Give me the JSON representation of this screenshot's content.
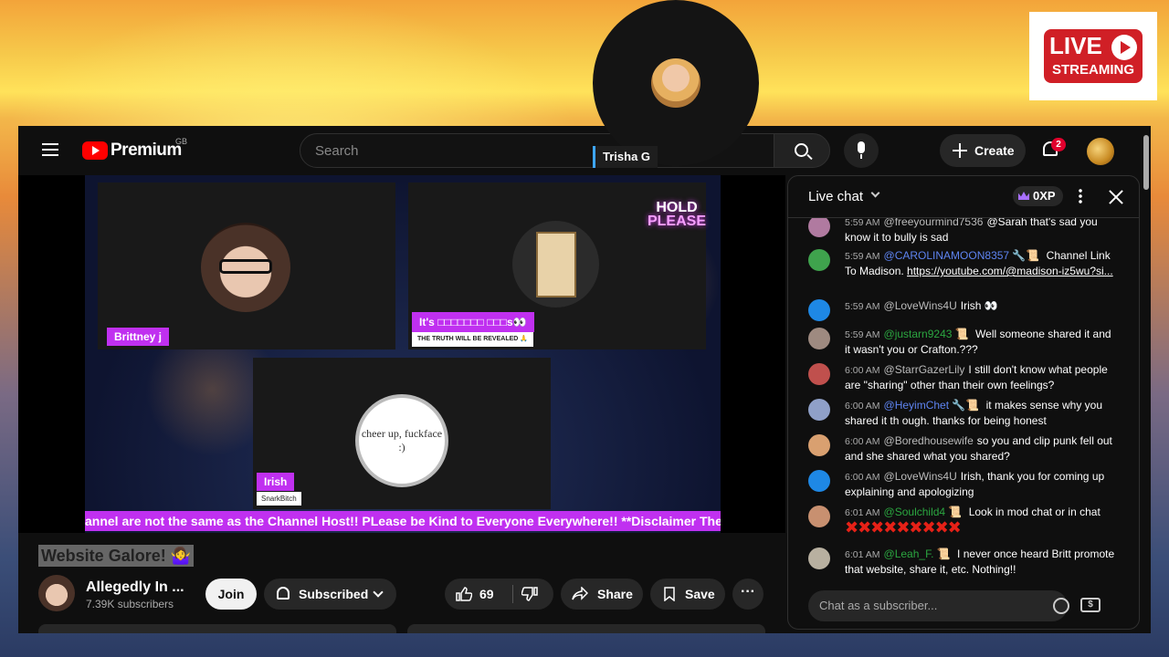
{
  "overlay": {
    "host_name": "Trisha G",
    "live_badge": {
      "word": "LIVE",
      "sub": "STREAMING"
    }
  },
  "topbar": {
    "logo_text": "Premium",
    "logo_region": "GB",
    "search_placeholder": "Search",
    "create_label": "Create",
    "notification_count": "2"
  },
  "video": {
    "participants": [
      {
        "name": "Brittney j"
      },
      {
        "name": "It's □□□□□□□ □□□s👀",
        "subtitle": "THE TRUTH WILL BE REVEALED 🙏"
      },
      {
        "name": "Irish",
        "subtitle": "SnarkBitch",
        "note": "cheer up, fuckface :)"
      }
    ],
    "hold_line1": "HOLD",
    "hold_line2": "PLEASE",
    "ticker": "annel are not the same as the Channel Host!! PLease be Kind to Everyone Everywhere!! **Disclaimer The M"
  },
  "meta": {
    "title": "Website Galore! 🤷‍♀️",
    "channel_name": "Allegedly In ...",
    "subscribers": "7.39K subscribers",
    "join_label": "Join",
    "subscribed_label": "Subscribed",
    "like_count": "69",
    "share_label": "Share",
    "save_label": "Save",
    "more_label": "···"
  },
  "chat": {
    "title": "Live chat",
    "xp": "0XP",
    "input_placeholder": "Chat as a subscriber...",
    "money_icon": "$",
    "messages": [
      {
        "time": "5:59 AM",
        "user": "@freeyourmind7536",
        "user_color": "#bbbbbb",
        "text": "@Sarah that's sad you know it to bully is sad",
        "avatar": "#b07aa0"
      },
      {
        "time": "5:59 AM",
        "user": "@CAROLINAMOON8357 🔧📜",
        "user_color": "#5e84f1",
        "text": "Channel Link To Madison.",
        "link": "https://youtube.com/@madison-iz5wu?si...",
        "avatar": "#3fa34d"
      },
      {
        "time": "5:59 AM",
        "user": "@LoveWins4U",
        "user_color": "#bbbbbb",
        "text": "Irish 👀",
        "avatar": "#1e88e5"
      },
      {
        "time": "5:59 AM",
        "user": "@justarn9243 📜",
        "user_color": "#2ba640",
        "text": "Well someone shared it and it wasn't you or Crafton.???",
        "avatar": "#9e8a80"
      },
      {
        "time": "6:00 AM",
        "user": "@StarrGazerLily",
        "user_color": "#bbbbbb",
        "text": "I still don't know what people are \"sharing\" other than their own feelings?",
        "avatar": "#c0504d"
      },
      {
        "time": "6:00 AM",
        "user": "@HeyimChet 🔧📜",
        "user_color": "#5e84f1",
        "text": "it makes sense why you shared it th ough. thanks for being honest",
        "avatar": "#8fa0c8"
      },
      {
        "time": "6:00 AM",
        "user": "@Boredhousewife",
        "user_color": "#bbbbbb",
        "text": "so you and clip punk fell out and she shared what you shared?",
        "avatar": "#d9a070"
      },
      {
        "time": "6:00 AM",
        "user": "@LoveWins4U",
        "user_color": "#bbbbbb",
        "text": "Irish, thank you for coming up explaining and apologizing",
        "avatar": "#1e88e5"
      },
      {
        "time": "6:01 AM",
        "user": "@Soulchild4 📜",
        "user_color": "#2ba640",
        "text": "Look in mod chat or in chat",
        "xmarks": "✖✖✖✖✖✖✖✖✖",
        "avatar": "#c89070"
      },
      {
        "time": "6:01 AM",
        "user": "@Leah_F. 📜",
        "user_color": "#2ba640",
        "text": "I never once heard Britt promote that website, share it, etc. Nothing!!",
        "avatar": "#b8b0a0"
      }
    ]
  },
  "colors": {
    "accent_red": "#ff0000",
    "member_green": "#2ba640",
    "mod_blue": "#5e84f1",
    "banner_purple": "#c030f0"
  }
}
